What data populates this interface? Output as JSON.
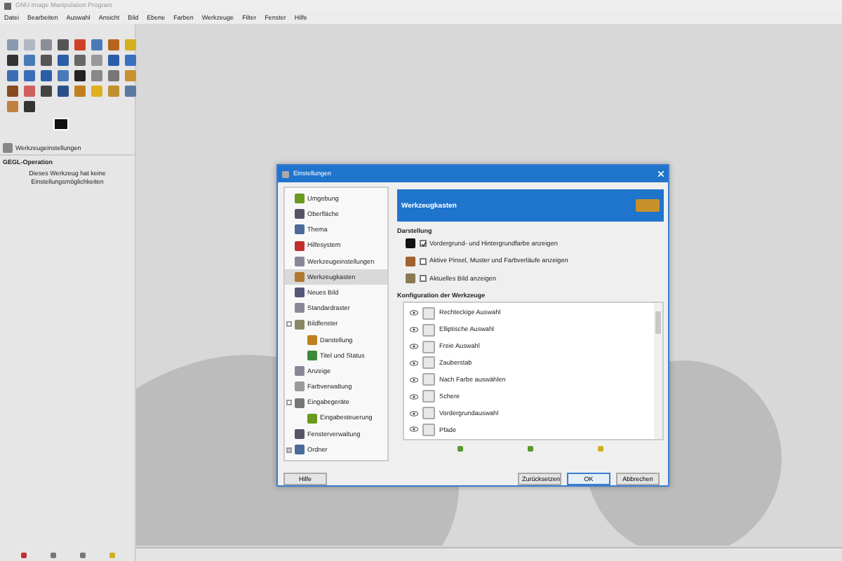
{
  "window": {
    "title": "GNU Image Manipulation Program"
  },
  "menu": [
    "Datei",
    "Bearbeiten",
    "Auswahl",
    "Ansicht",
    "Bild",
    "Ebene",
    "Farben",
    "Werkzeuge",
    "Filter",
    "Fenster",
    "Hilfe"
  ],
  "tool_options": {
    "tab": "Werkzeugeinstellungen",
    "title": "GEGL-Operation",
    "message": "Dieses Werkzeug hat keine Einstellungsmöglichkeiten"
  },
  "dialog": {
    "title": "Einstellungen",
    "categories": [
      {
        "label": "Umgebung",
        "selected": false
      },
      {
        "label": "Oberfläche",
        "selected": false
      },
      {
        "label": "Thema",
        "selected": false
      },
      {
        "label": "Hilfesystem",
        "selected": false
      },
      {
        "label": "Werkzeugeinstellungen",
        "selected": false
      },
      {
        "label": "Werkzeugkasten",
        "selected": true
      },
      {
        "label": "Neues Bild",
        "selected": false
      },
      {
        "label": "Standardraster",
        "selected": false
      },
      {
        "label": "Bildfenster",
        "selected": false,
        "expanded": true,
        "children": [
          {
            "label": "Darstellung",
            "selected": false
          },
          {
            "label": "Titel und Status",
            "selected": false
          }
        ]
      },
      {
        "label": "Anzeige",
        "selected": false
      },
      {
        "label": "Farbverwaltung",
        "selected": false
      },
      {
        "label": "Eingabegeräte",
        "selected": false,
        "expanded": true,
        "children": [
          {
            "label": "Eingabesteuerung",
            "selected": false
          }
        ]
      },
      {
        "label": "Fensterverwaltung",
        "selected": false
      },
      {
        "label": "Ordner",
        "selected": false,
        "expanded": false
      }
    ],
    "header": "Werkzeugkasten",
    "section_1": "Darstellung",
    "options": [
      {
        "label": "Vordergrund- und Hintergrundfarbe anzeigen",
        "checked": true
      },
      {
        "label": "Aktive Pinsel, Muster und Farbverläufe anzeigen",
        "checked": false
      },
      {
        "label": "Aktuelles Bild anzeigen",
        "checked": false
      }
    ],
    "section_2": "Konfiguration der Werkzeuge",
    "tools": [
      {
        "label": "Rechteckige Auswahl",
        "visible": true
      },
      {
        "label": "Elliptische Auswahl",
        "visible": true
      },
      {
        "label": "Freie Auswahl",
        "visible": true
      },
      {
        "label": "Zauberstab",
        "visible": true
      },
      {
        "label": "Nach Farbe auswählen",
        "visible": true
      },
      {
        "label": "Schere",
        "visible": true
      },
      {
        "label": "Vordergrundauswahl",
        "visible": true
      },
      {
        "label": "Pfade",
        "visible": true
      }
    ],
    "buttons": [
      {
        "label": "Hilfe",
        "default": false
      },
      {
        "label": "Zurücksetzen",
        "default": false
      },
      {
        "label": "OK",
        "default": true
      },
      {
        "label": "Abbrechen",
        "default": false
      }
    ]
  }
}
